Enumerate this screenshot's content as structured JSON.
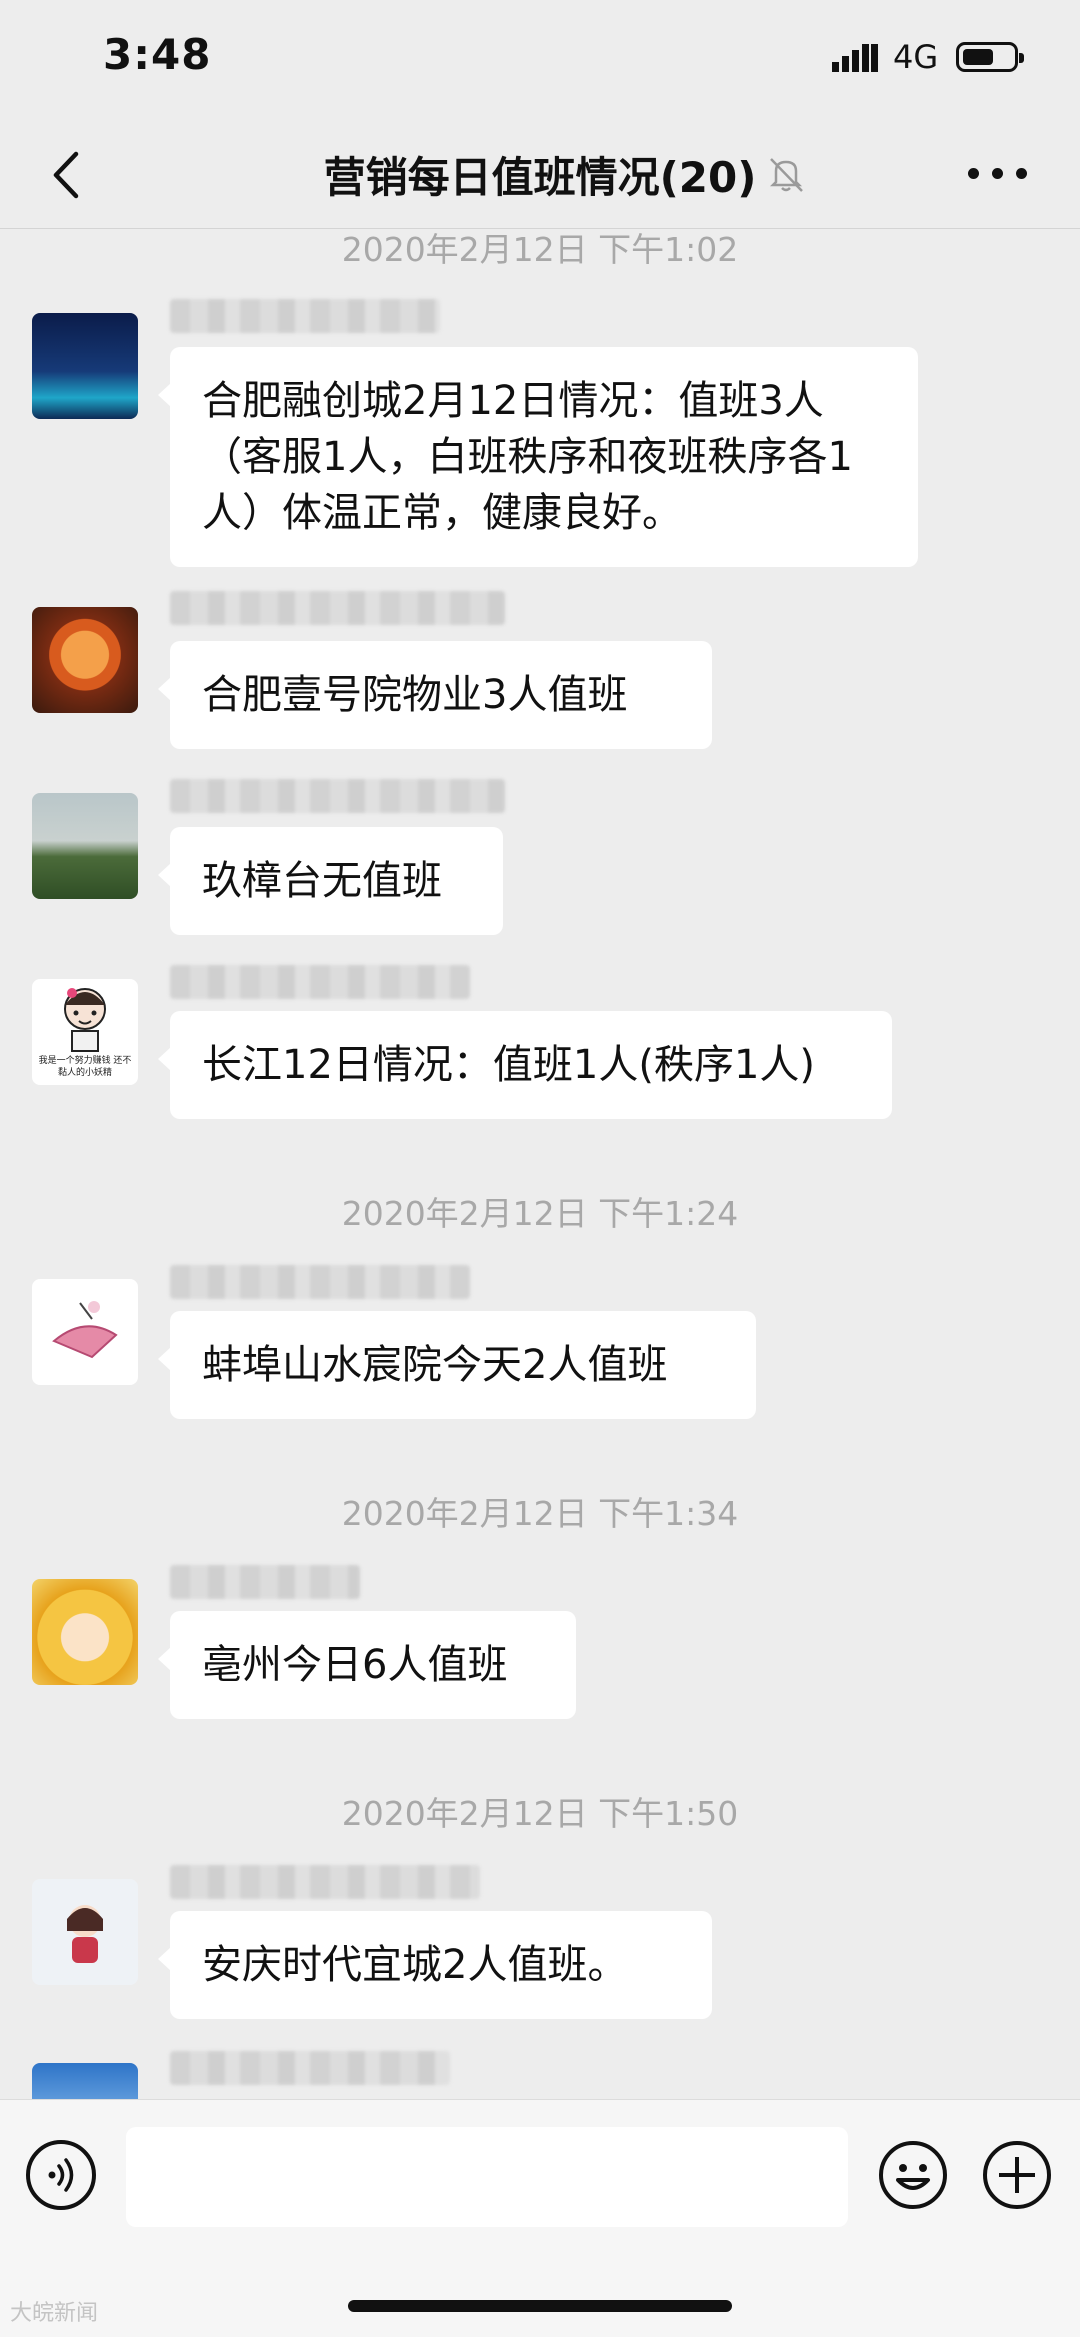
{
  "status_bar": {
    "time": "3:48",
    "network": "4G"
  },
  "header": {
    "title": "营销每日值班情况(20)"
  },
  "messages": [
    {
      "timestamp": "2020年2月12日 下午1:02"
    },
    {
      "text": "合肥融创城2月12日情况：值班3人（客服1人，白班秩序和夜班秩序各1人）体温正常，健康良好。"
    },
    {
      "text": "合肥壹号院物业3人值班"
    },
    {
      "text": "玖樟台无值班"
    },
    {
      "text": "长江12日情况：值班1人(秩序1人)"
    },
    {
      "timestamp": "2020年2月12日 下午1:24"
    },
    {
      "text": "蚌埠山水宸院今天2人值班"
    },
    {
      "timestamp": "2020年2月12日 下午1:34"
    },
    {
      "text": "亳州今日6人值班"
    },
    {
      "timestamp": "2020年2月12日 下午1:50"
    },
    {
      "text": "安庆时代宜城2人值班。"
    }
  ],
  "avatar_captions": {
    "m4": "我是一个努力赚钱 还不黏人的小妖精"
  },
  "watermark": "大皖新闻",
  "icons": [
    "signal-icon",
    "battery-icon",
    "back-arrow-icon",
    "mute-bell-icon",
    "more-dots-icon",
    "voice-icon",
    "emoji-icon",
    "plus-icon"
  ]
}
